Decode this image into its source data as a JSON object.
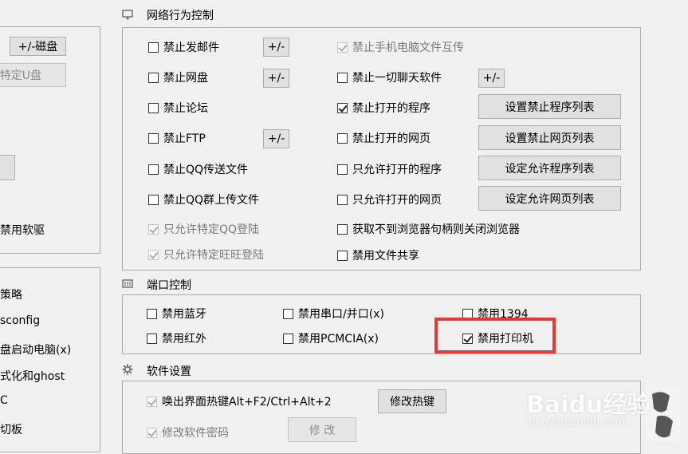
{
  "left_panel": {
    "buttons": {
      "disk_btn": "+/-磁盘",
      "specific_usb_btn": "特定U盘"
    },
    "disable_floppy": "禁用软驱",
    "items": [
      "策略",
      "sconfig",
      "盘启动电脑(x)",
      "式化和ghost",
      "C",
      "切板"
    ]
  },
  "network": {
    "title": "网络行为控制",
    "left_items": [
      {
        "label": "禁止发邮件",
        "checked": false,
        "disabled": false,
        "btn": "+/-"
      },
      {
        "label": "禁止网盘",
        "checked": false,
        "disabled": false,
        "btn": "+/-"
      },
      {
        "label": "禁止论坛",
        "checked": false,
        "disabled": false
      },
      {
        "label": "禁止FTP",
        "checked": false,
        "disabled": false,
        "btn": "+/-"
      },
      {
        "label": "禁止QQ传送文件",
        "checked": false,
        "disabled": false
      },
      {
        "label": "禁止QQ群上传文件",
        "checked": false,
        "disabled": false
      },
      {
        "label": "只允许特定QQ登陆",
        "checked": true,
        "disabled": true
      },
      {
        "label": "只允许特定旺旺登陆",
        "checked": true,
        "disabled": true
      }
    ],
    "right_items": [
      {
        "label": "禁止手机电脑文件互传",
        "checked": true,
        "disabled": true
      },
      {
        "label": "禁止一切聊天软件",
        "checked": false,
        "disabled": false,
        "btn": "+/-"
      },
      {
        "label": "禁止打开的程序",
        "checked": true,
        "disabled": false,
        "btn": "设置禁止程序列表"
      },
      {
        "label": "禁止打开的网页",
        "checked": false,
        "disabled": false,
        "btn": "设置禁止网页列表"
      },
      {
        "label": "只允许打开的程序",
        "checked": false,
        "disabled": false,
        "btn": "设定允许程序列表"
      },
      {
        "label": "只允许打开的网页",
        "checked": false,
        "disabled": false,
        "btn": "设定允许网页列表"
      },
      {
        "label": "获取不到浏览器句柄则关闭浏览器",
        "checked": false,
        "disabled": false
      },
      {
        "label": "禁用文件共享",
        "checked": false,
        "disabled": false
      }
    ]
  },
  "port": {
    "title": "端口控制",
    "items": [
      {
        "label": "禁用蓝牙",
        "checked": false
      },
      {
        "label": "禁用串口/并口(x)",
        "checked": false
      },
      {
        "label": "禁用1394",
        "checked": false
      },
      {
        "label": "禁用红外",
        "checked": false
      },
      {
        "label": "禁用PCMCIA(x)",
        "checked": false
      },
      {
        "label": "禁用打印机",
        "checked": true
      }
    ]
  },
  "software": {
    "title": "软件设置",
    "hotkey_label": "唤出界面热键Alt+F2/Ctrl+Alt+2",
    "hotkey_btn": "修改热键",
    "password_label": "修改软件密码",
    "password_btn": "修 改"
  },
  "watermark": {
    "brand": "Baidu经验",
    "url": "jingyan.baidu.com"
  },
  "colors": {
    "highlight": "#e23b36",
    "window_bg": "#f0f0f0",
    "border": "#adadad"
  }
}
